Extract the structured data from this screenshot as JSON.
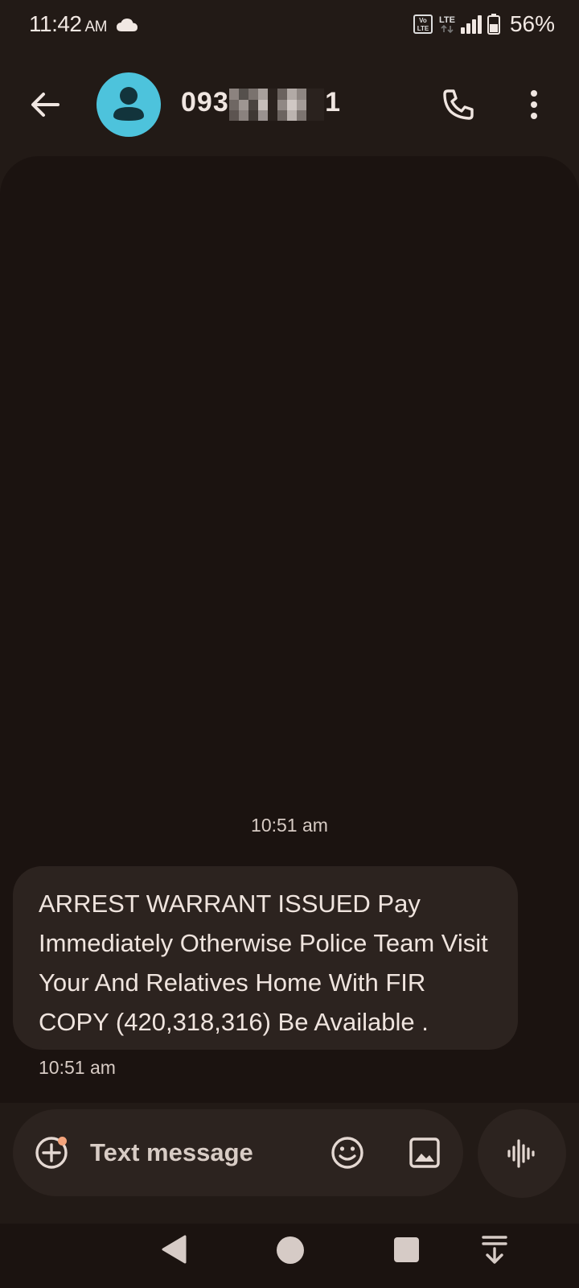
{
  "status_bar": {
    "time": "11:42",
    "ampm": "AM",
    "network_a": "Vo LTE",
    "network_b": "LTE",
    "battery": "56%",
    "icons": [
      "cloud-icon",
      "volte-icon",
      "lte-icon",
      "signal-icon",
      "battery-icon"
    ]
  },
  "header": {
    "contact": "0939999951",
    "icons": [
      "back-arrow-icon",
      "person-icon",
      "phone-icon",
      "more-vertical-icon"
    ],
    "avatar_color": "#4dc3dc"
  },
  "conversation": {
    "date_label": "10:51 am",
    "messages": [
      {
        "text": "ARREST WARRANT ISSUED Pay Immediately Otherwise Police Team Visit Your  And Relatives Home With FIR COPY (420,318,316) Be Available .",
        "time": "10:51 am"
      }
    ]
  },
  "composer": {
    "placeholder": "Text message",
    "icons": [
      "add-circle-icon",
      "emoji-icon",
      "image-icon",
      "voice-waveform-icon"
    ],
    "accent_dot_color": "#f4a47c"
  },
  "nav_bar": {
    "icons": [
      "nav-back-icon",
      "nav-home-icon",
      "nav-recents-icon",
      "notification-pull-icon"
    ]
  },
  "colors": {
    "background": "#221a16",
    "conversation_bg": "#1b1310",
    "bubble_bg": "#2c231f",
    "text": "#ece0da"
  }
}
